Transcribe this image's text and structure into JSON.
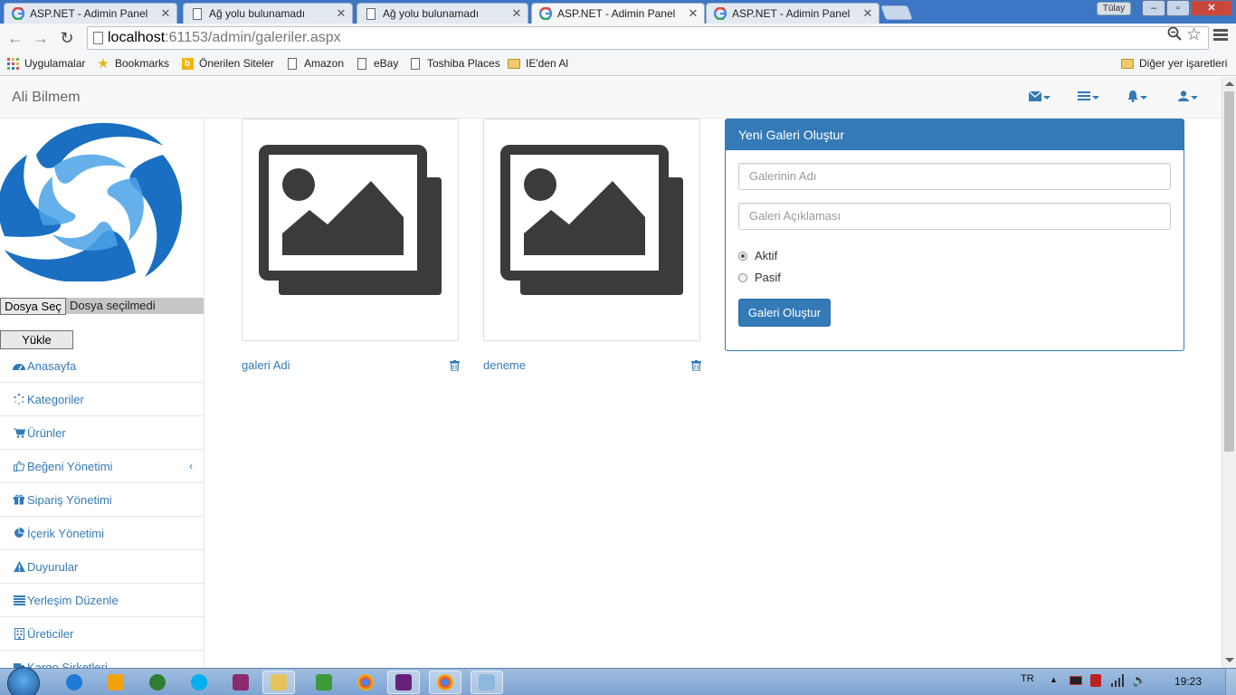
{
  "browser": {
    "tabs": [
      {
        "label": "ASP.NET - Adimin Panel",
        "icon": "google-icon",
        "active": false
      },
      {
        "label": "Ağ yolu bulunamadı",
        "icon": "page-icon",
        "active": false
      },
      {
        "label": "Ağ yolu bulunamadı",
        "icon": "page-icon",
        "active": false
      },
      {
        "label": "ASP.NET - Adimin Panel",
        "icon": "google-icon",
        "active": true
      },
      {
        "label": "ASP.NET - Adimin Panel",
        "icon": "google-icon",
        "active": false
      }
    ],
    "user": "Tülay",
    "url_host": "localhost",
    "url_path": ":61153/admin/galeriler.aspx",
    "bookmarks": [
      {
        "label": "Uygulamalar",
        "icon": "apps-icon"
      },
      {
        "label": "Bookmarks",
        "icon": "star-icon"
      },
      {
        "label": "Önerilen Siteler",
        "icon": "bing-icon"
      },
      {
        "label": "Amazon",
        "icon": "page-icon"
      },
      {
        "label": "eBay",
        "icon": "page-icon"
      },
      {
        "label": "Toshiba Places",
        "icon": "page-icon"
      },
      {
        "label": "IE'den Al",
        "icon": "folder-icon"
      }
    ],
    "other_bookmarks": "Diğer yer işaretleri"
  },
  "header": {
    "brand": "Ali Bilmem",
    "icons": [
      "envelope-icon",
      "tasks-icon",
      "bell-icon",
      "user-icon"
    ]
  },
  "sidebar": {
    "file_button": "Dosya Seç",
    "file_status": "Dosya seçilmedi",
    "upload_button": "Yükle",
    "items": [
      {
        "label": "Anasayfa",
        "icon": "dashboard-icon"
      },
      {
        "label": "Kategoriler",
        "icon": "spinner-icon"
      },
      {
        "label": "Ürünler",
        "icon": "cart-icon"
      },
      {
        "label": "Beğeni Yönetimi",
        "icon": "thumbs-up-icon",
        "arrow": "‹"
      },
      {
        "label": "Sipariş Yönetimi",
        "icon": "gift-icon"
      },
      {
        "label": "İçerik Yönetimi",
        "icon": "pie-chart-icon"
      },
      {
        "label": "Duyurular",
        "icon": "warning-icon"
      },
      {
        "label": "Yerleşim Düzenle",
        "icon": "list-icon"
      },
      {
        "label": "Üreticiler",
        "icon": "building-icon"
      },
      {
        "label": "Kargo Şirketleri",
        "icon": "truck-icon"
      }
    ]
  },
  "galleries": [
    {
      "name": "galeri Adi"
    },
    {
      "name": "deneme"
    }
  ],
  "panel": {
    "title": "Yeni Galeri Oluştur",
    "name_placeholder": "Galerinin Adı",
    "desc_placeholder": "Galeri Açıklaması",
    "radio_active": "Aktif",
    "radio_passive": "Pasif",
    "selected": "Aktif",
    "submit": "Galeri Oluştur"
  },
  "taskbar": {
    "lang": "TR",
    "time": "19:23"
  },
  "colors": {
    "primary": "#337ab7",
    "tabstrip": "#3d76c4",
    "logo_blue": "#1a6fc2"
  }
}
